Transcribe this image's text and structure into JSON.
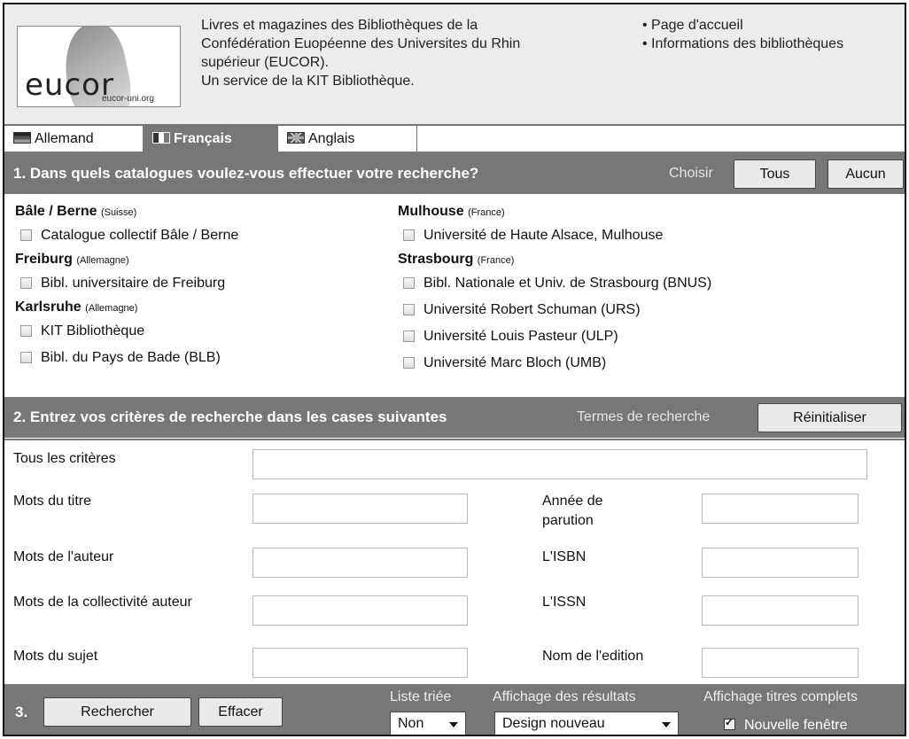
{
  "header": {
    "logo_text": "eucor",
    "logo_url": "eucor-uni.org",
    "intro_lines": [
      "Livres et magazines des Bibliothèques de la",
      "Confédération Euopéenne des Universites du Rhin",
      "supérieur (EUCOR).",
      "Un service de la KIT Bibliothèque."
    ],
    "nav": [
      "• Page d'accueil",
      "• Informations des bibliothèques"
    ]
  },
  "languages": [
    {
      "label": "Allemand",
      "icon": "german-flag-icon",
      "active": false
    },
    {
      "label": "Français",
      "icon": "french-flag-icon",
      "active": true
    },
    {
      "label": "Anglais",
      "icon": "uk-flag-icon",
      "active": false
    }
  ],
  "section1": {
    "title": "1. Dans quels catalogues voulez-vous effectuer votre recherche?",
    "choose_label": "Choisir",
    "all_button": "Tous",
    "none_button": "Aucun",
    "left": [
      {
        "group": "Bâle / Berne",
        "country": "(Suisse)",
        "items": [
          "Catalogue collectif Bâle / Berne"
        ]
      },
      {
        "group": "Freiburg",
        "country": "(Allemagne)",
        "items": [
          "Bibl. universitaire de Freiburg"
        ]
      },
      {
        "group": "Karlsruhe",
        "country": "(Allemagne)",
        "items": [
          "KIT Bibliothèque",
          "Bibl. du Pays de Bade (BLB)"
        ]
      }
    ],
    "right": [
      {
        "group": "Mulhouse",
        "country": "(France)",
        "items": [
          "Université de Haute Alsace, Mulhouse"
        ]
      },
      {
        "group": "Strasbourg",
        "country": "(France)",
        "items": [
          "Bibl. Nationale et Univ. de Strasbourg (BNUS)",
          "Université Robert Schuman (URS)",
          "Université Louis Pasteur (ULP)",
          "Université Marc Bloch (UMB)"
        ]
      }
    ]
  },
  "section2": {
    "title": "2. Entrez vos critères de recherche dans les cases suivantes",
    "terms_label": "Termes de recherche",
    "reset_button": "Réinitialiser",
    "fields": {
      "all": {
        "label": "Tous les critères",
        "value": ""
      },
      "title": {
        "label": "Mots du titre",
        "value": ""
      },
      "author": {
        "label": "Mots de l'auteur",
        "value": ""
      },
      "corporate": {
        "label": "Mots de la collectivité auteur",
        "value": ""
      },
      "subject": {
        "label": "Mots du sujet",
        "value": ""
      },
      "year": {
        "label": "Année de parution",
        "value": ""
      },
      "isbn": {
        "label": "L'ISBN",
        "value": ""
      },
      "issn": {
        "label": "L'ISSN",
        "value": ""
      },
      "publisher": {
        "label": "Nom de l'edition",
        "value": ""
      }
    }
  },
  "section3": {
    "number": "3.",
    "search_button": "Rechercher",
    "clear_button": "Effacer",
    "sorted_label": "Liste triée",
    "sorted_value": "Non",
    "display_label": "Affichage des résultats",
    "display_value": "Design nouveau",
    "full_titles_label": "Affichage titres complets",
    "new_window_label": "Nouvelle fenêtre",
    "new_window_checked": true
  }
}
